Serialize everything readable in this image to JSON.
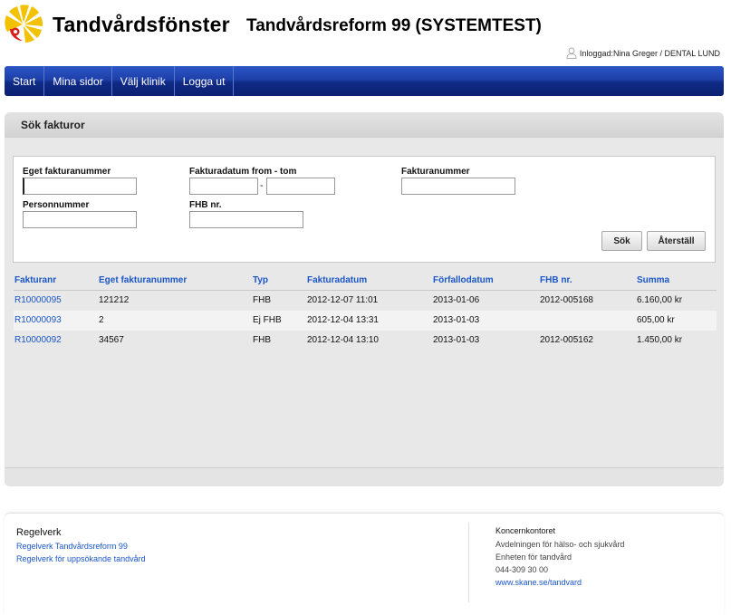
{
  "header": {
    "brand": "Tandvårdsfönster",
    "system_title": "Tandvårdsreform 99 (SYSTEMTEST)",
    "login_text": "Inloggad:Nina Greger / DENTAL LUND"
  },
  "nav": {
    "items": [
      "Start",
      "Mina sidor",
      "Välj klinik",
      "Logga ut"
    ]
  },
  "search": {
    "title": "Sök fakturor",
    "labels": {
      "own_invoice": "Eget fakturanummer",
      "date_range": "Fakturadatum from - tom",
      "invoice_no": "Fakturanummer",
      "personal_no": "Personnummer",
      "fhb_no": "FHB nr."
    },
    "values": {
      "own_invoice": "",
      "date_from": "",
      "date_to": "",
      "invoice_no": "",
      "personal_no": "",
      "fhb_no": ""
    },
    "date_separator": "-",
    "search_button": "Sök",
    "reset_button": "Återställ"
  },
  "table": {
    "columns": [
      "Fakturanr",
      "Eget fakturanummer",
      "Typ",
      "Fakturadatum",
      "Förfallodatum",
      "FHB nr.",
      "Summa"
    ],
    "rows": [
      [
        "R10000095",
        "121212",
        "FHB",
        "2012-12-07 11:01",
        "2013-01-06",
        "2012-005168",
        "6.160,00 kr"
      ],
      [
        "R10000093",
        "2",
        "Ej FHB",
        "2012-12-04 13:31",
        "2013-01-03",
        "",
        "605,00 kr"
      ],
      [
        "R10000092",
        "34567",
        "FHB",
        "2012-12-04 13:10",
        "2013-01-03",
        "2012-005162",
        "1.450,00 kr"
      ]
    ]
  },
  "footer": {
    "rules_title": "Regelverk",
    "rules_links": [
      "Regelverk Tandvårdsreform 99",
      "Regelverk för uppsökande tandvård"
    ],
    "contact_title": "Koncernkontoret",
    "contact_lines": [
      "Avdelningen för hälso- och sjukvård",
      "Enheten för tandvård",
      "044-309 30 00"
    ],
    "contact_link": "www.skane.se/tandvard"
  },
  "colors": {
    "nav_blue": "#1e3fa8",
    "link_blue": "#1a56c7",
    "logo_yellow": "#f2c200",
    "logo_red": "#d9211c"
  }
}
